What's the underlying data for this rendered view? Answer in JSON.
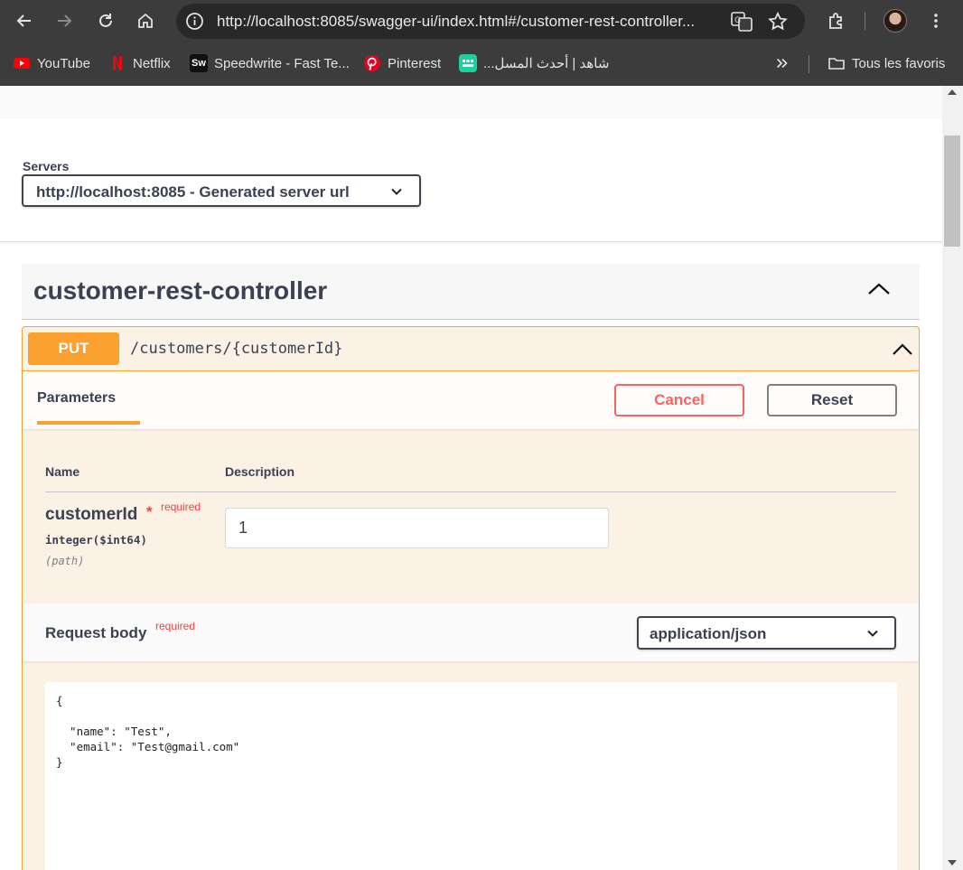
{
  "browser": {
    "url": "http://localhost:8085/swagger-ui/index.html#/customer-rest-controller...",
    "bookmarks": [
      {
        "label": "YouTube",
        "icon": "youtube-icon"
      },
      {
        "label": "Netflix",
        "icon": "netflix-icon"
      },
      {
        "label": "Speedwrite - Fast Te...",
        "icon": "speedwrite-icon"
      },
      {
        "label": "Pinterest",
        "icon": "pinterest-icon"
      },
      {
        "label": "شاهد | أحدث المسل...",
        "icon": "shahid-icon"
      }
    ],
    "all_bookmarks_label": "Tous les favoris",
    "sw_badge": "Sw"
  },
  "servers": {
    "label": "Servers",
    "selected": "http://localhost:8085 - Generated server url"
  },
  "tag": {
    "title": "customer-rest-controller"
  },
  "operation": {
    "method": "PUT",
    "path": "/customers/{customerId}",
    "tab_parameters": "Parameters",
    "cancel_label": "Cancel",
    "reset_label": "Reset",
    "table": {
      "col_name": "Name",
      "col_description": "Description"
    },
    "param": {
      "name": "customerId",
      "required_star": "*",
      "required_label": "required",
      "type": "integer($int64)",
      "in": "(path)",
      "value": "1"
    },
    "request_body": {
      "title": "Request body",
      "required_label": "required",
      "content_type": "application/json",
      "code_lines": [
        "{",
        "",
        "  \"name\": \"Test\",",
        "  \"email\": \"Test@gmail.com\"",
        "}"
      ]
    }
  },
  "colors": {
    "put": "#fca130",
    "cancel": "#ff6060",
    "chrome_bg": "#3c3c3c"
  }
}
